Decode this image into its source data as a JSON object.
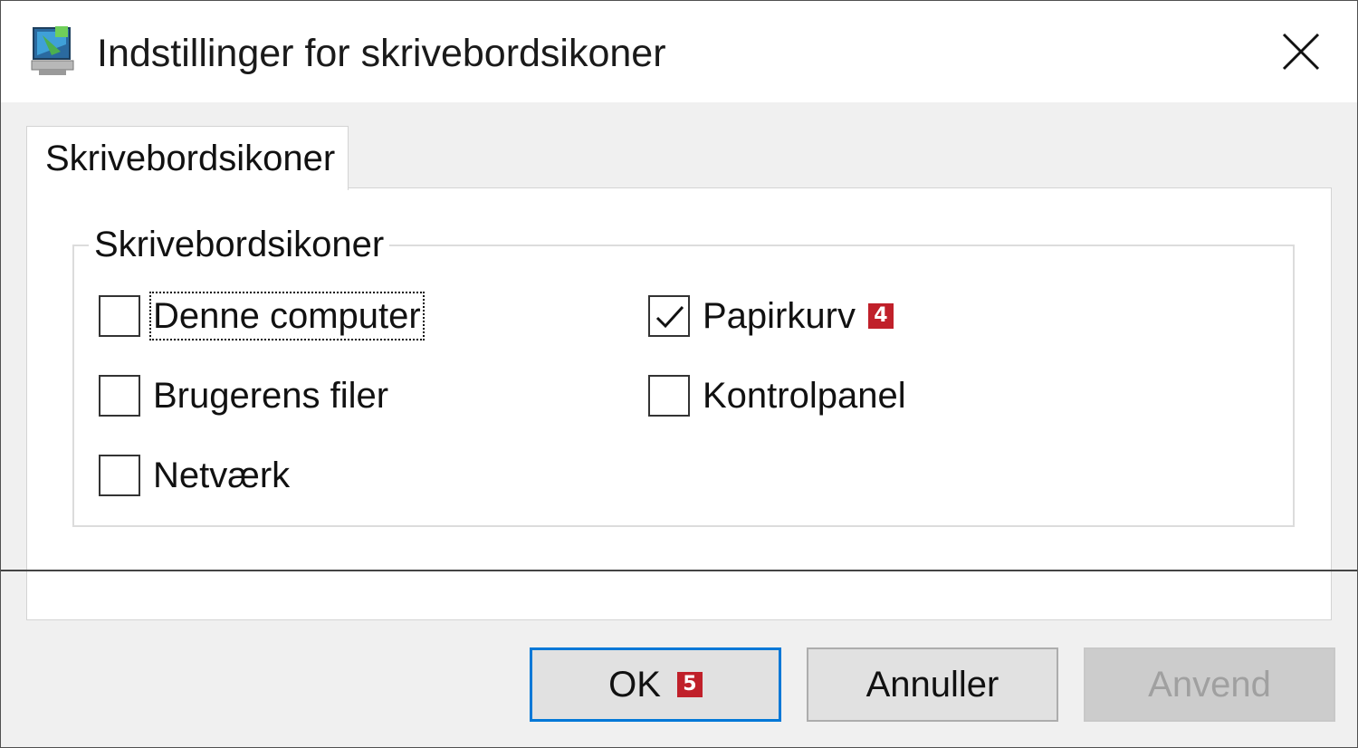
{
  "dialog": {
    "title": "Indstillinger for skrivebordsikoner"
  },
  "tab": {
    "label": "Skrivebordsikoner"
  },
  "group": {
    "legend": "Skrivebordsikoner"
  },
  "checkboxes": {
    "denne_computer": {
      "label": "Denne computer",
      "checked": false
    },
    "brugerens_filer": {
      "label": "Brugerens filer",
      "checked": false
    },
    "netvaerk": {
      "label": "Netværk",
      "checked": false
    },
    "papirkurv": {
      "label": "Papirkurv",
      "checked": true,
      "badge": "4"
    },
    "kontrolpanel": {
      "label": "Kontrolpanel",
      "checked": false
    }
  },
  "buttons": {
    "ok": {
      "label": "OK",
      "badge": "5"
    },
    "cancel": {
      "label": "Annuller"
    },
    "apply": {
      "label": "Anvend",
      "disabled": true
    }
  },
  "colors": {
    "badge": "#c0202a",
    "default_button_border": "#0078d7"
  },
  "icons": {
    "title": "desktop-settings-icon",
    "close": "close-icon",
    "check": "checkmark-icon"
  }
}
